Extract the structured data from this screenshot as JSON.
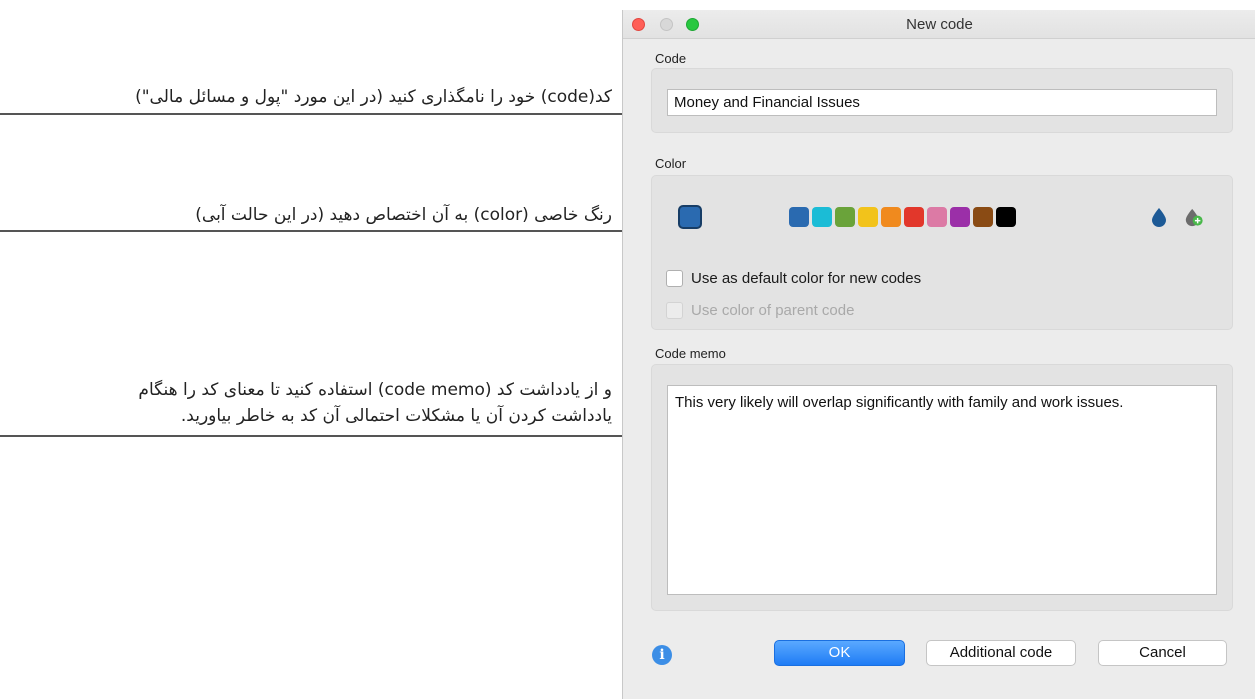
{
  "annotations": {
    "name_code": "کد(code) خود را نامگذاری کنید (در این مورد \"پول و مسائل مالی\")",
    "color": "رنگ خاصی (color)  به آن اختصاص دهید (در این حالت آبی)",
    "memo_line1": "و از یادداشت کد (code memo) استفاده کنید تا معنای کد را هنگام",
    "memo_line2": "یادداشت کردن آن یا مشکلات احتمالی آن کد به خاطر بیاورید."
  },
  "window": {
    "title": "New code"
  },
  "code_section": {
    "label": "Code",
    "value": "Money and Financial Issues"
  },
  "color_section": {
    "label": "Color",
    "current_color": "#2a6ab0",
    "palette": [
      "#2a6ab0",
      "#1bbcd6",
      "#6aa33a",
      "#f2c31b",
      "#f08a1e",
      "#e2372b",
      "#dc7aa5",
      "#9b2fa8",
      "#8a4b14",
      "#000000"
    ],
    "icons": [
      "drop-icon",
      "drop-add-icon"
    ],
    "default_color_checkbox": "Use as default color for new codes",
    "parent_color_checkbox": "Use color of parent code"
  },
  "memo_section": {
    "label": "Code memo",
    "text": "This very likely will overlap significantly with family and work issues."
  },
  "buttons": {
    "ok": "OK",
    "additional": "Additional code",
    "cancel": "Cancel"
  }
}
